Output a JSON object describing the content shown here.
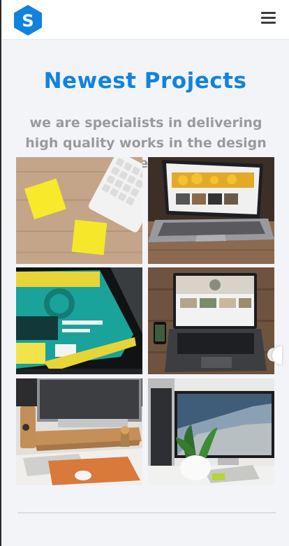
{
  "navbar": {
    "logo_letter": "S",
    "logo_icon": "hexagon-logo-icon",
    "menu_icon": "hamburger-menu-icon"
  },
  "section": {
    "title": "Newest Projects",
    "subtitle": "we are specialists in delivering high quality works in the design field"
  },
  "gallery": {
    "tiles": [
      {
        "name": "sticky-notes-keyboard-photo"
      },
      {
        "name": "laptop-on-wooden-table-photo"
      },
      {
        "name": "smartphone-app-closeup-photo"
      },
      {
        "name": "laptop-and-phone-desk-photo"
      },
      {
        "name": "imac-workspace-photo"
      },
      {
        "name": "monitor-with-plant-photo"
      }
    ]
  },
  "colors": {
    "accent": "#1183df",
    "subtitle": "#9a9a9a",
    "background": "#f3f4f8"
  }
}
